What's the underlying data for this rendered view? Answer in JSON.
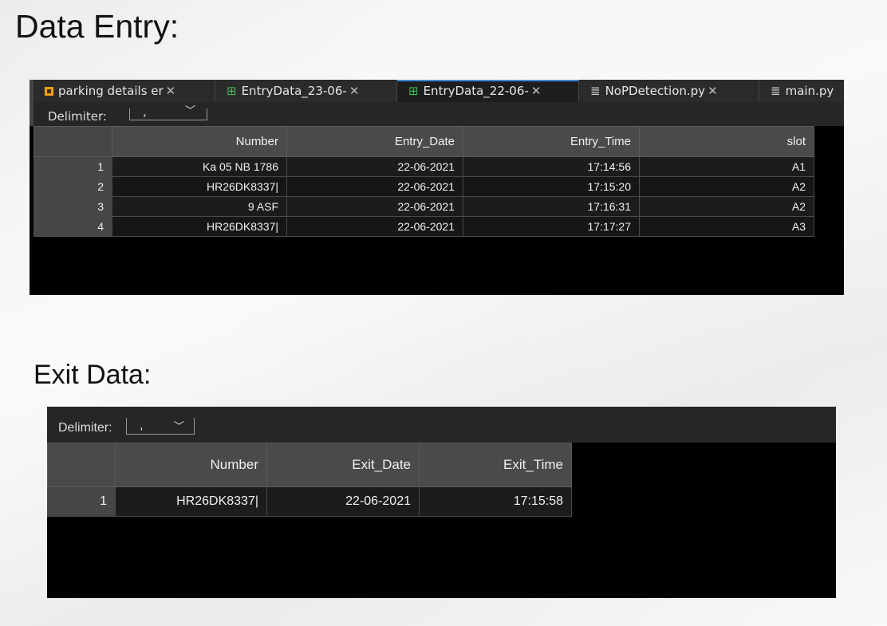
{
  "headings": {
    "entry": "Data Entry:",
    "exit": "Exit Data:"
  },
  "tabs": [
    {
      "label": "parking details er",
      "icon": "image-icon"
    },
    {
      "label": "EntryData_23-06-",
      "icon": "table-icon"
    },
    {
      "label": "EntryData_22-06-",
      "icon": "table-icon",
      "active": true
    },
    {
      "label": "NoPDetection.py",
      "icon": "text-file-icon"
    },
    {
      "label": "main.py",
      "icon": "text-file-icon"
    }
  ],
  "tab_close": "✕",
  "delimiter": {
    "label": "Delimiter:",
    "value": ","
  },
  "entry_table": {
    "columns": [
      "Number",
      "Entry_Date",
      "Entry_Time",
      "slot"
    ],
    "rows": [
      [
        "1",
        "Ka 05 NB 1786",
        "22-06-2021",
        "17:14:56",
        "A1"
      ],
      [
        "2",
        "HR26DK8337|",
        "22-06-2021",
        "17:15:20",
        "A2"
      ],
      [
        "3",
        "9 ASF",
        "22-06-2021",
        "17:16:31",
        "A2"
      ],
      [
        "4",
        "HR26DK8337|",
        "22-06-2021",
        "17:17:27",
        "A3"
      ]
    ]
  },
  "exit_table": {
    "columns": [
      "Number",
      "Exit_Date",
      "Exit_Time"
    ],
    "rows": [
      [
        "1",
        "HR26DK8337|",
        "22-06-2021",
        "17:15:58"
      ]
    ]
  },
  "colors": {
    "active_tab_accent": "#3d8fd6",
    "table_header": "#4a4a4a",
    "background": "#000000"
  }
}
